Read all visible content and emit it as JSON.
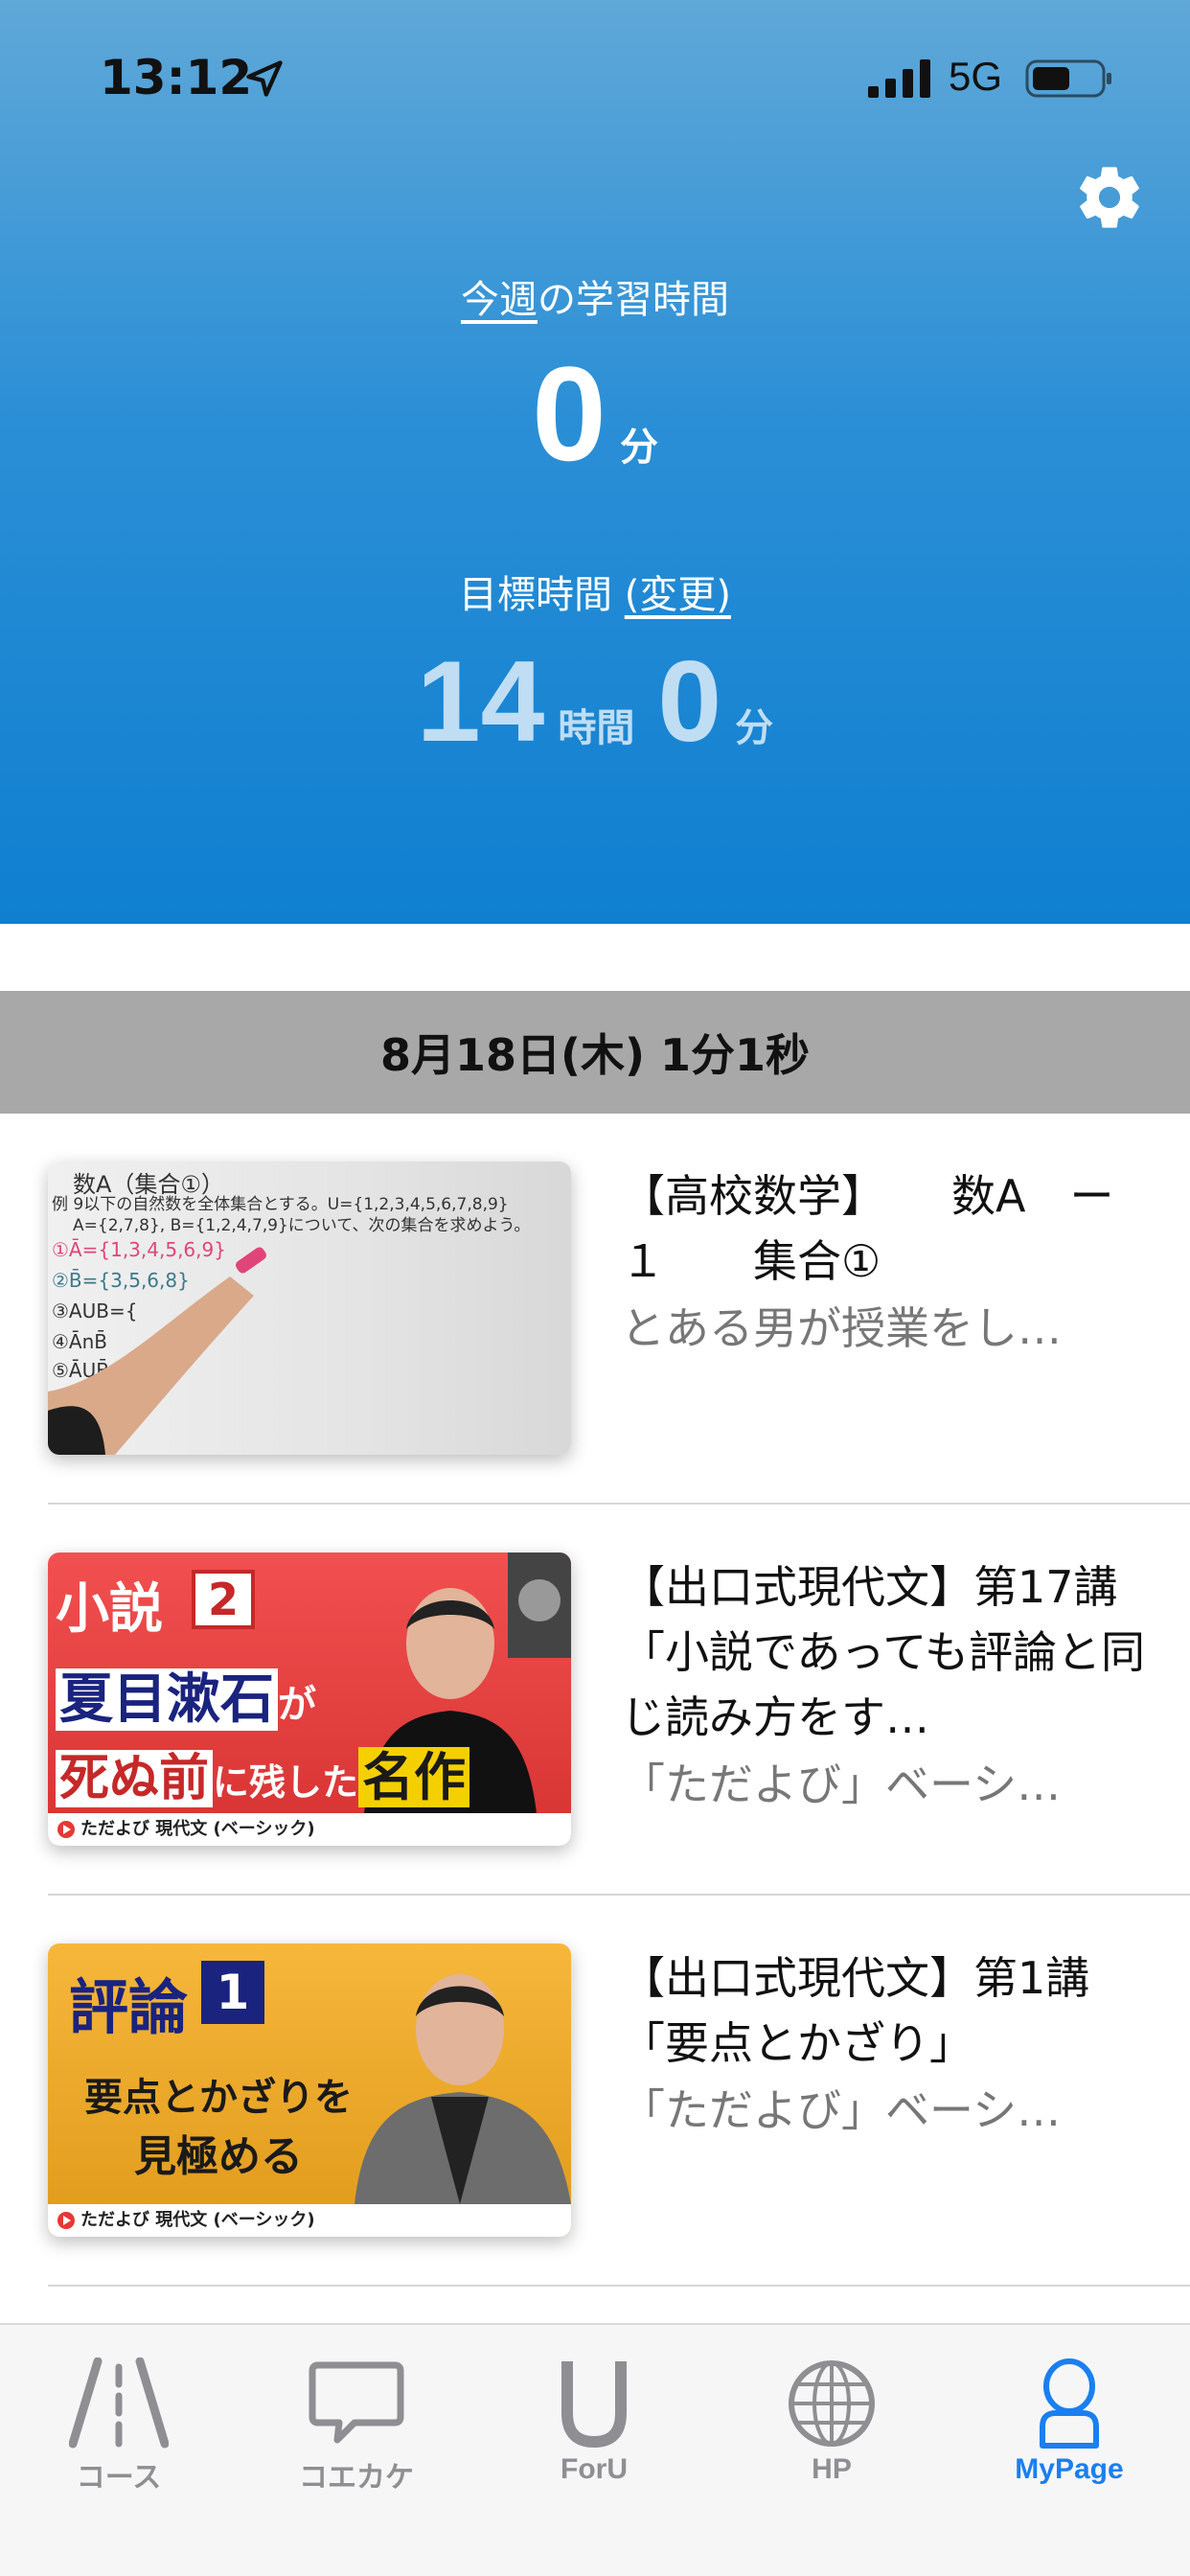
{
  "status_bar": {
    "time": "13:12",
    "network": "5G"
  },
  "header": {
    "week_label_link": "今週",
    "week_label_rest": "の学習時間",
    "week_minutes": "0",
    "minute_unit": "分",
    "goal_label": "目標時間",
    "goal_change_link": "(変更)",
    "goal_hours": "14",
    "hour_unit": "時間",
    "goal_minutes": "0"
  },
  "date_band": "8月18日(木) 1分1秒",
  "items": [
    {
      "title": "【高校数学】　　数A　ー１　　集合①",
      "subtitle": "とある男が授業をし…",
      "thumb": {
        "lines": [
          "数A（集合①）",
          "例 9以下の自然数を全体集合とする。U={1,2,3,4,5,6,7,8,9}",
          "A={2,7,8}, B={1,2,4,7,9}について、次の集合を求めよう。",
          "①Ā={1,3,4,5,6,9}",
          "②B̄={3,5,6,8}",
          "③AUB={",
          "④ĀnB̄",
          "⑤ĀUB̄"
        ]
      }
    },
    {
      "title": "【出口式現代文】第17講「小説であっても評論と同じ読み方をす…",
      "subtitle": "「ただよび」ベーシ…",
      "thumb": {
        "tag": "小説",
        "num": "2",
        "line1": "夏目漱石",
        "line1b": "が",
        "line2a": "死ぬ前",
        "line2b": "に残した",
        "line2c": "名作",
        "footer_brand": "ただよび",
        "footer_text": "現代文 (ベーシック)"
      }
    },
    {
      "title": "【出口式現代文】第1講「要点とかざり」",
      "subtitle": "「ただよび」ベーシ…",
      "thumb": {
        "tag": "評論",
        "num": "1",
        "line1": "要点とかざりを",
        "line2": "見極める",
        "footer_brand": "ただよび",
        "footer_text": "現代文 (ベーシック)"
      }
    }
  ],
  "tabs": [
    {
      "label": "コース",
      "icon": "road-icon",
      "active": false
    },
    {
      "label": "コエカケ",
      "icon": "speech-bubble-icon",
      "active": false
    },
    {
      "label": "ForU",
      "icon": "u-letter-icon",
      "active": false
    },
    {
      "label": "HP",
      "icon": "globe-icon",
      "active": false
    },
    {
      "label": "MyPage",
      "icon": "person-icon",
      "active": true
    }
  ],
  "colors": {
    "header_top": "#5fa8d8",
    "header_bottom": "#0f7fd0",
    "date_band": "#a8a8a8",
    "tab_active": "#1a7ff0",
    "tab_inactive": "#8e8e93"
  }
}
